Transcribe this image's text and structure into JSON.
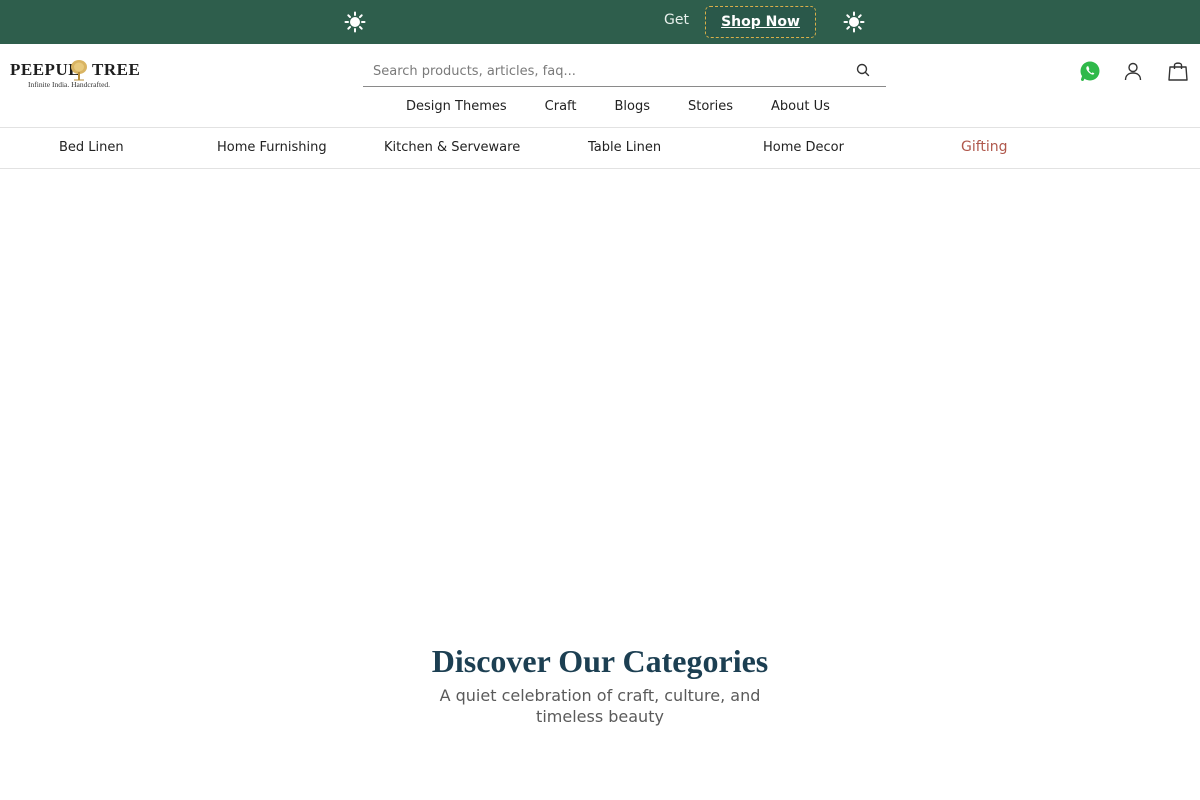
{
  "promo": {
    "text": "Get",
    "button_label": "Shop Now",
    "bg_color": "#2e5e4c",
    "icons": [
      "sun-icon",
      "sun-icon"
    ]
  },
  "header": {
    "logo": {
      "word_left": "PEEPUL",
      "word_right": "TREE",
      "tagline": "Infinite India. Handcrafted."
    },
    "search": {
      "placeholder": "Search products, articles, faq...",
      "value": ""
    },
    "icons": [
      "whatsapp-icon",
      "account-icon",
      "shopping-bag-icon"
    ],
    "subnav": [
      "Design Themes",
      "Craft",
      "Blogs",
      "Stories",
      "About Us"
    ]
  },
  "categories": {
    "items": [
      "Bed Linen",
      "Home Furnishing",
      "Kitchen & Serveware",
      "Table Linen",
      "Home Decor"
    ],
    "highlight": "Gifting",
    "highlight_color": "#b0584c"
  },
  "discover": {
    "title": "Discover Our Categories",
    "subtitle": "A quiet celebration of craft, culture, and timeless beauty"
  }
}
